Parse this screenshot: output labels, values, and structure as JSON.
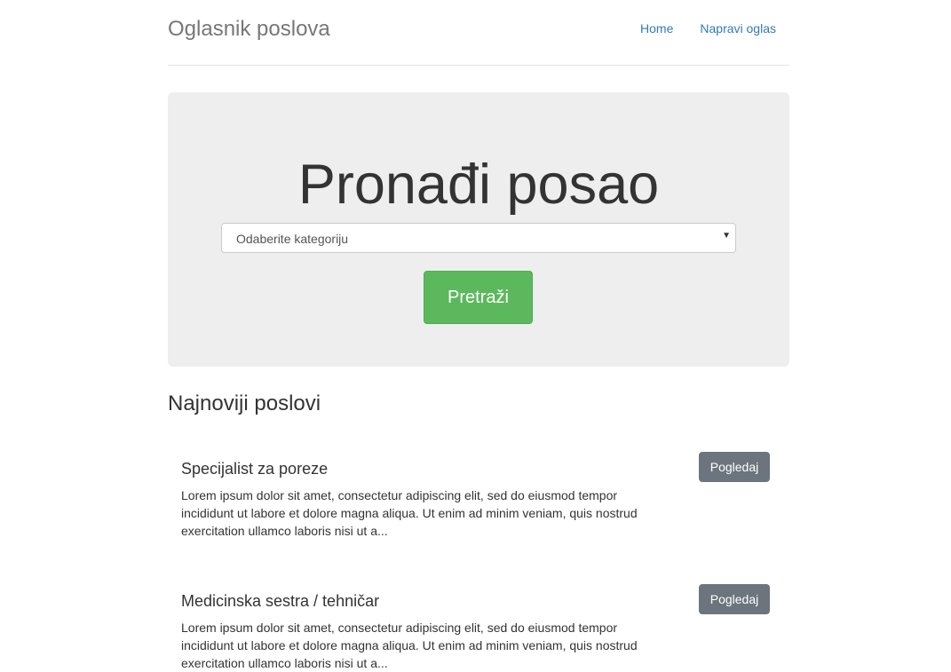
{
  "header": {
    "brand": "Oglasnik poslova",
    "nav": [
      {
        "label": "Home"
      },
      {
        "label": "Napravi oglas"
      }
    ]
  },
  "hero": {
    "title": "Pronađi posao",
    "category_select": {
      "selected": "Odaberite kategoriju"
    },
    "search_button": "Pretraži"
  },
  "latest": {
    "title": "Najnoviji poslovi",
    "jobs": [
      {
        "title": "Specijalist za poreze",
        "description": "Lorem ipsum dolor sit amet, consectetur adipiscing elit, sed do eiusmod tempor incididunt ut labore et dolore magna aliqua. Ut enim ad minim veniam, quis nostrud exercitation ullamco laboris nisi ut a...",
        "button": "Pogledaj"
      },
      {
        "title": "Medicinska sestra / tehničar",
        "description": "Lorem ipsum dolor sit amet, consectetur adipiscing elit, sed do eiusmod tempor incididunt ut labore et dolore magna aliqua. Ut enim ad minim veniam, quis nostrud exercitation ullamco laboris nisi ut a...",
        "button": "Pogledaj"
      }
    ]
  },
  "colors": {
    "link": "#337ab7",
    "success": "#5cb85c",
    "secondary": "#6c757d",
    "jumbotron": "#eeeeee"
  }
}
